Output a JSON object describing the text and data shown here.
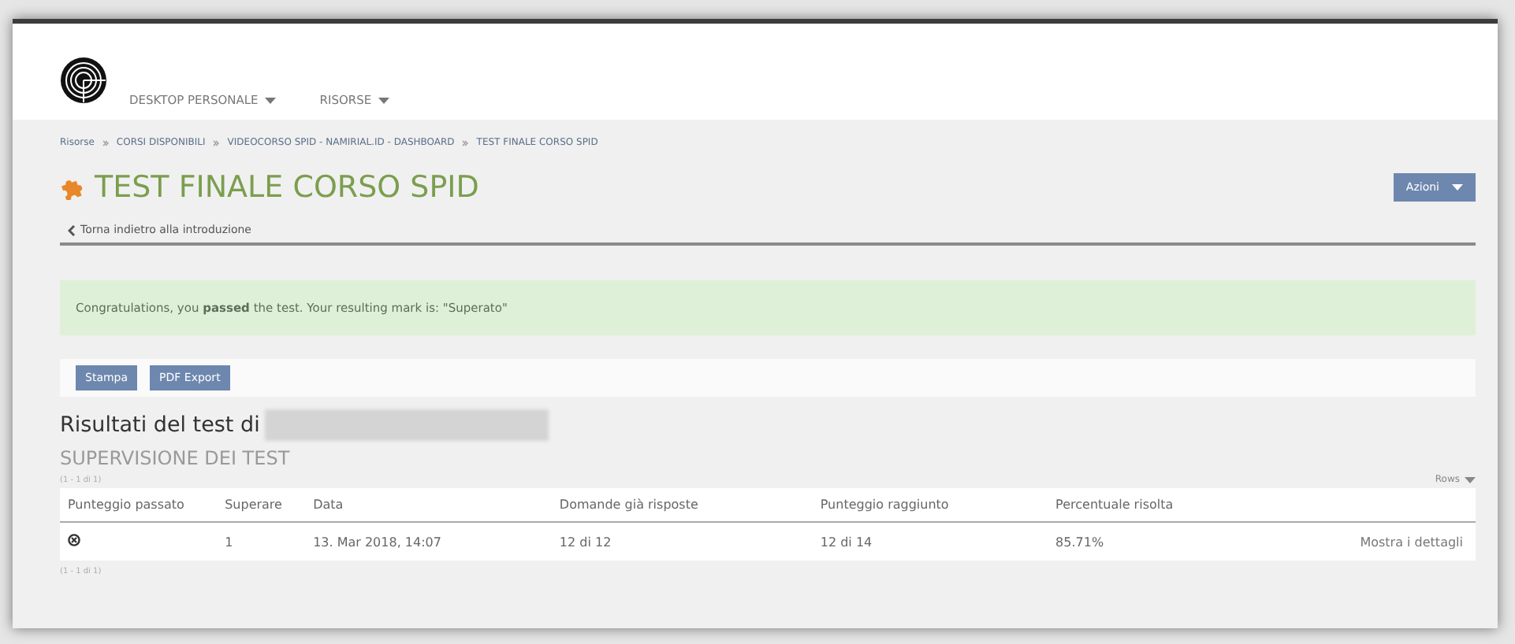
{
  "nav": {
    "items": [
      {
        "label": "DESKTOP PERSONALE"
      },
      {
        "label": "RISORSE"
      }
    ]
  },
  "breadcrumb": [
    "Risorse",
    "CORSI DISPONIBILI",
    "VIDEOCORSO SPID - NAMIRIAL.ID - DASHBOARD",
    "TEST FINALE CORSO SPID"
  ],
  "title": "TEST FINALE CORSO SPID",
  "actions_button": "Azioni",
  "back_link": "Torna indietro alla introduzione",
  "alert": "Congratulations, you **passed** the test. Your resulting mark is: \"Superato\"",
  "toolbar": [
    "Stampa",
    "PDF Export"
  ],
  "results_heading": "Risultati del test di",
  "section_title": "SUPERVISIONE DEI TEST",
  "table": {
    "count_top": "(1 - 1 di 1)",
    "rows_menu": "Rows",
    "columns": [
      "Punteggio passato",
      "Superare",
      "Data",
      "Domande già risposte",
      "Punteggio raggiunto",
      "Percentuale risolta"
    ],
    "rows": [
      {
        "cells": [
          "",
          "1",
          "13. Mar 2018, 14:07",
          "12 di 12",
          "12 di 14",
          "85.71%",
          "Mostra i dettagli"
        ]
      }
    ],
    "count_bottom": "(1 - 1 di 1)"
  }
}
